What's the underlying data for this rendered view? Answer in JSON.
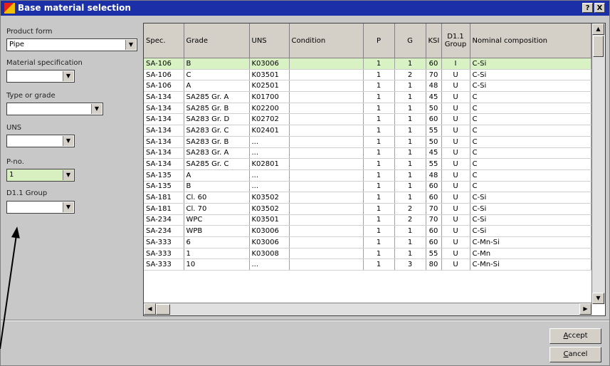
{
  "window": {
    "title": "Base material selection"
  },
  "titlebar_buttons": {
    "help": "?",
    "close": "X"
  },
  "filters": {
    "product_form": {
      "label": "Product form",
      "value": "Pipe"
    },
    "material_specification": {
      "label": "Material specification",
      "value": ""
    },
    "type_or_grade": {
      "label": "Type or grade",
      "value": ""
    },
    "uns": {
      "label": "UNS",
      "value": ""
    },
    "p_no": {
      "label": "P-no.",
      "value": "1"
    },
    "d11_group": {
      "label": "D1.1 Group",
      "value": ""
    }
  },
  "table": {
    "headers": [
      "Spec.",
      "Grade",
      "UNS",
      "Condition",
      "P",
      "G",
      "KSI",
      "D1.1 Group",
      "Nominal composition"
    ],
    "rows": [
      [
        "SA-106",
        "B",
        "K03006",
        "",
        "1",
        "1",
        "60",
        "I",
        "C-Si"
      ],
      [
        "SA-106",
        "C",
        "K03501",
        "",
        "1",
        "2",
        "70",
        "U",
        "C-Si"
      ],
      [
        "SA-106",
        "A",
        "K02501",
        "",
        "1",
        "1",
        "48",
        "U",
        "C-Si"
      ],
      [
        "SA-134",
        "SA285 Gr. A",
        "K01700",
        "",
        "1",
        "1",
        "45",
        "U",
        "C"
      ],
      [
        "SA-134",
        "SA285 Gr. B",
        "K02200",
        "",
        "1",
        "1",
        "50",
        "U",
        "C"
      ],
      [
        "SA-134",
        "SA283 Gr. D",
        "K02702",
        "",
        "1",
        "1",
        "60",
        "U",
        "C"
      ],
      [
        "SA-134",
        "SA283 Gr. C",
        "K02401",
        "",
        "1",
        "1",
        "55",
        "U",
        "C"
      ],
      [
        "SA-134",
        "SA283 Gr. B",
        "...",
        "",
        "1",
        "1",
        "50",
        "U",
        "C"
      ],
      [
        "SA-134",
        "SA283 Gr. A",
        "...",
        "",
        "1",
        "1",
        "45",
        "U",
        "C"
      ],
      [
        "SA-134",
        "SA285 Gr. C",
        "K02801",
        "",
        "1",
        "1",
        "55",
        "U",
        "C"
      ],
      [
        "SA-135",
        "A",
        "...",
        "",
        "1",
        "1",
        "48",
        "U",
        "C"
      ],
      [
        "SA-135",
        "B",
        "...",
        "",
        "1",
        "1",
        "60",
        "U",
        "C"
      ],
      [
        "SA-181",
        "Cl. 60",
        "K03502",
        "",
        "1",
        "1",
        "60",
        "U",
        "C-Si"
      ],
      [
        "SA-181",
        "Cl. 70",
        "K03502",
        "",
        "1",
        "2",
        "70",
        "U",
        "C-Si"
      ],
      [
        "SA-234",
        "WPC",
        "K03501",
        "",
        "1",
        "2",
        "70",
        "U",
        "C-Si"
      ],
      [
        "SA-234",
        "WPB",
        "K03006",
        "",
        "1",
        "1",
        "60",
        "U",
        "C-Si"
      ],
      [
        "SA-333",
        "6",
        "K03006",
        "",
        "1",
        "1",
        "60",
        "U",
        "C-Mn-Si"
      ],
      [
        "SA-333",
        "1",
        "K03008",
        "",
        "1",
        "1",
        "55",
        "U",
        "C-Mn"
      ],
      [
        "SA-333",
        "10",
        "...",
        "",
        "1",
        "3",
        "80",
        "U",
        "C-Mn-Si"
      ]
    ],
    "selected_row": 0
  },
  "buttons": {
    "accept": {
      "first": "A",
      "rest": "ccept"
    },
    "cancel": {
      "first": "C",
      "rest": "ancel"
    }
  },
  "colors": {
    "title_bar": "#1a2fa8",
    "selected_row": "#d8f2c4",
    "p_no_field": "#d8f0c0"
  }
}
